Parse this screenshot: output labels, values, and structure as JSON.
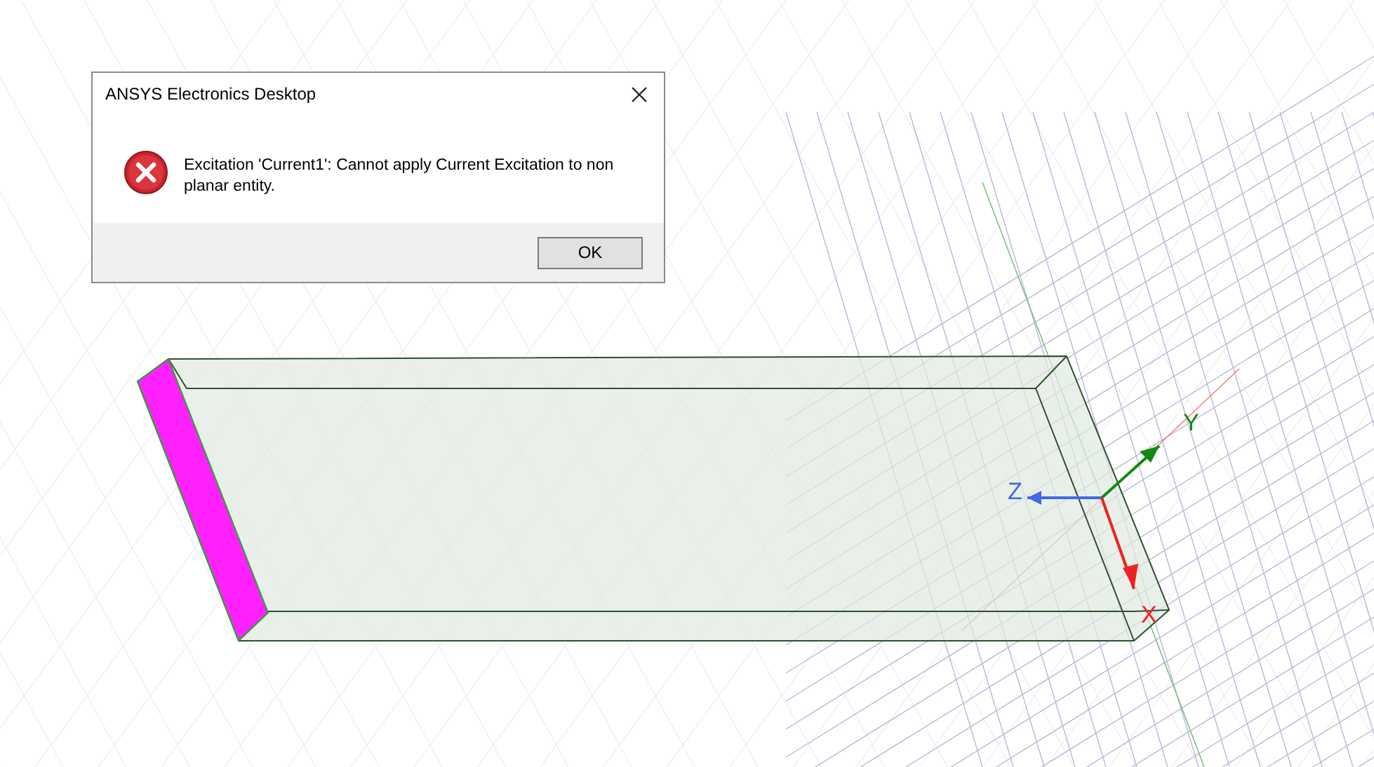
{
  "dialog": {
    "title": "ANSYS Electronics Desktop",
    "message": "Excitation 'Current1': Cannot apply Current Excitation to non planar entity.",
    "buttons": [
      "OK"
    ]
  },
  "viewport": {
    "axes": [
      {
        "kind": "z",
        "label": "Z",
        "color": "#4169e1"
      },
      {
        "kind": "y",
        "label": "Y",
        "color": "#128a12"
      },
      {
        "kind": "x",
        "label": "X",
        "color": "#ee2222"
      }
    ]
  }
}
